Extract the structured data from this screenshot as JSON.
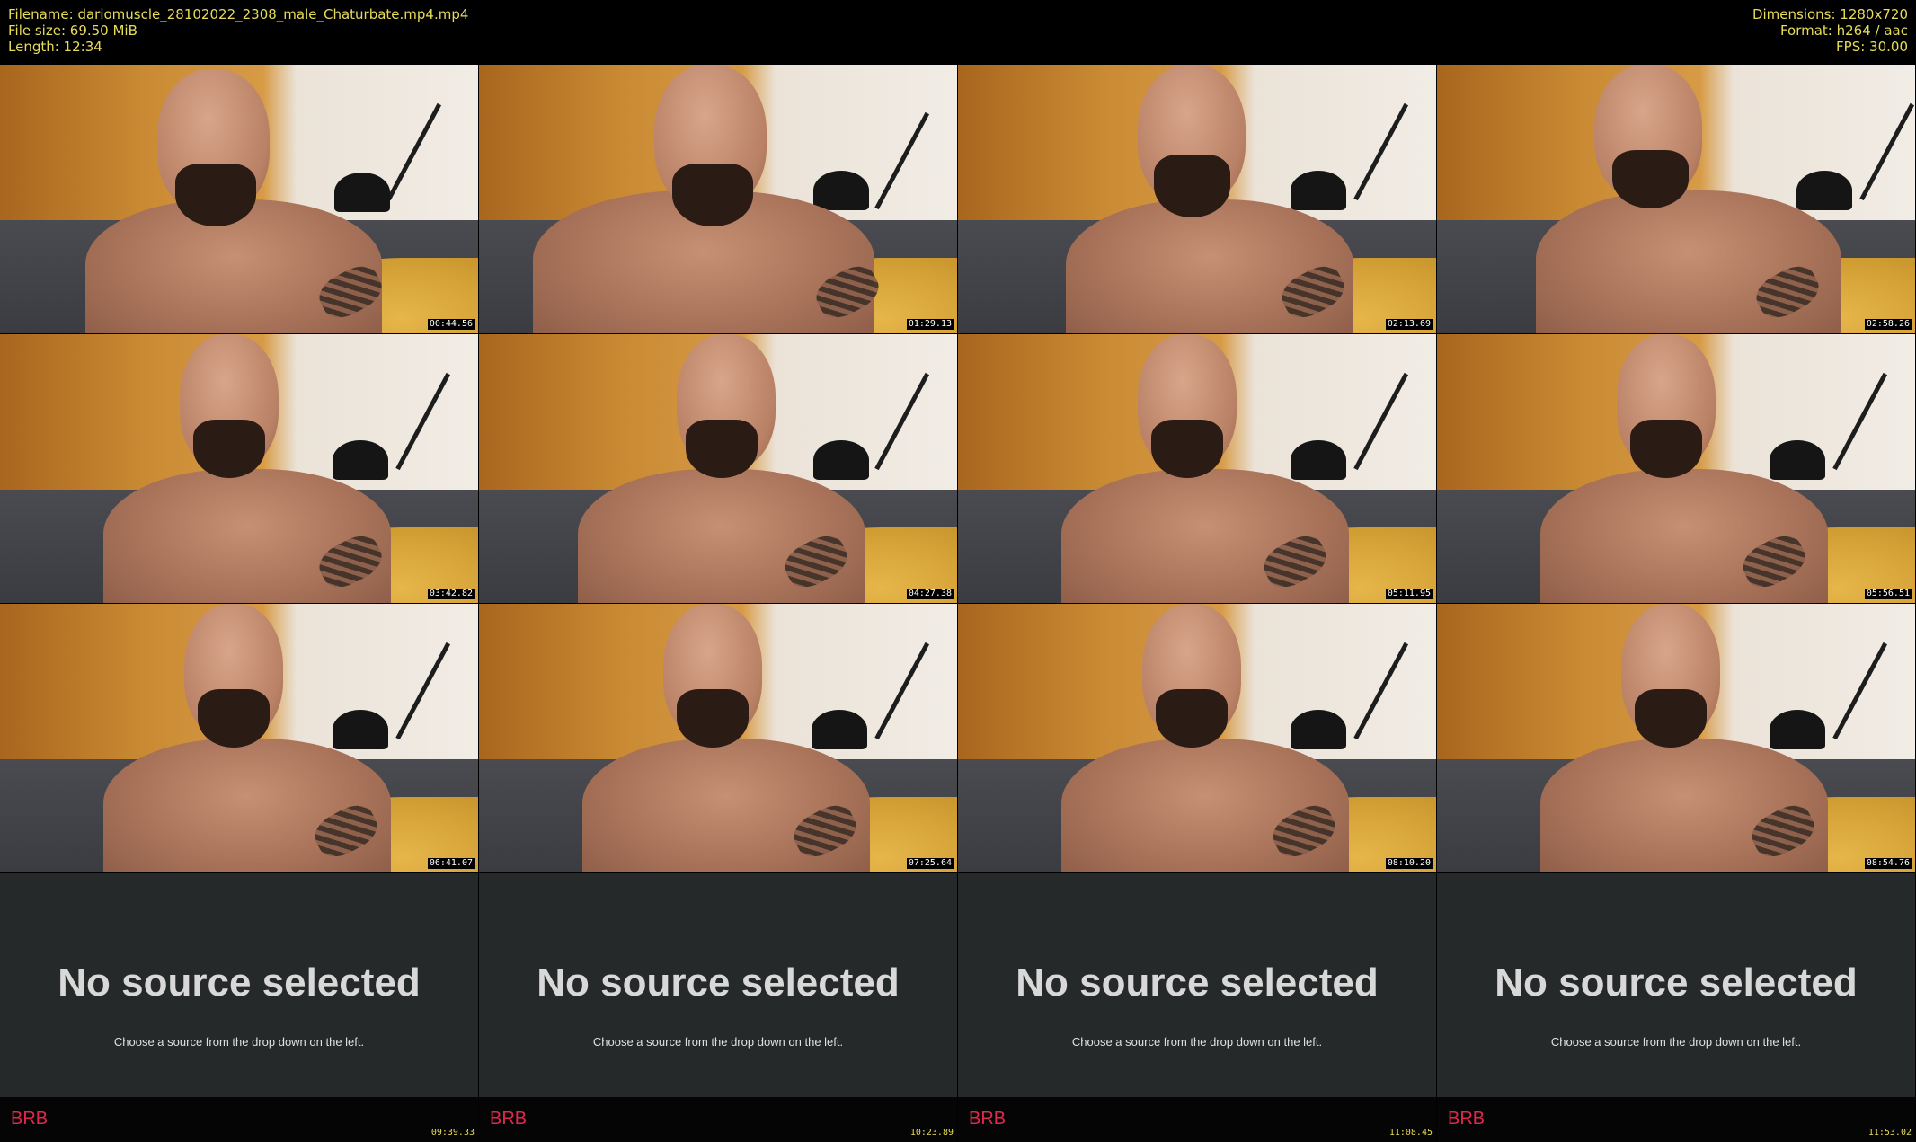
{
  "header": {
    "filename_line": "Filename: dariomuscle_28102022_2308_male_Chaturbate.mp4.mp4",
    "filesize_line": "File size: 69.50 MiB",
    "length_line": "Length: 12:34",
    "dimensions_line": "Dimensions: 1280x720",
    "format_line": "Format: h264 / aac",
    "fps_line": "FPS: 30.00"
  },
  "thumbnails": [
    {
      "timestamp": "00:44.56"
    },
    {
      "timestamp": "01:29.13"
    },
    {
      "timestamp": "02:13.69"
    },
    {
      "timestamp": "02:58.26"
    },
    {
      "timestamp": "03:42.82"
    },
    {
      "timestamp": "04:27.38"
    },
    {
      "timestamp": "05:11.95"
    },
    {
      "timestamp": "05:56.51"
    },
    {
      "timestamp": "06:41.07"
    },
    {
      "timestamp": "07:25.64"
    },
    {
      "timestamp": "08:10.20"
    },
    {
      "timestamp": "08:54.76"
    }
  ],
  "no_source_frames": [
    {
      "title": "No source selected",
      "subtitle": "Choose a source from the drop down on the left.",
      "brb": "BRB",
      "timestamp": "09:39.33"
    },
    {
      "title": "No source selected",
      "subtitle": "Choose a source from the drop down on the left.",
      "brb": "BRB",
      "timestamp": "10:23.89"
    },
    {
      "title": "No source selected",
      "subtitle": "Choose a source from the drop down on the left.",
      "brb": "BRB",
      "timestamp": "11:08.45"
    },
    {
      "title": "No source selected",
      "subtitle": "Choose a source from the drop down on the left.",
      "brb": "BRB",
      "timestamp": "11:53.02"
    }
  ],
  "colors": {
    "header_text": "#e6dc5a",
    "brb_text": "#e0284e",
    "no_source_bg": "#262829"
  }
}
